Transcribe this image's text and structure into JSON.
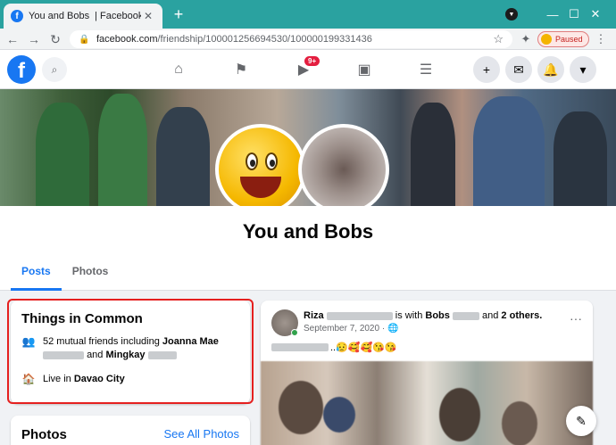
{
  "browser": {
    "tab_title_left": "You and Bobs",
    "tab_title_right": "| Facebook",
    "url_host": "facebook.com",
    "url_path": "/friendship/100001256694530/100000199331436",
    "profile_status": "Paused"
  },
  "fb_nav": {
    "notification_badge": "9+"
  },
  "page": {
    "title": "You and Bobs",
    "tabs": [
      "Posts",
      "Photos"
    ]
  },
  "things_in_common": {
    "title": "Things in Common",
    "mutual_prefix": "52 mutual friends including",
    "friend1_first": "Joanna Mae",
    "mutual_and": "and",
    "friend2_first": "Mingkay",
    "live_prefix": "Live in",
    "city": "Davao City"
  },
  "photos_card": {
    "title": "Photos",
    "see_all": "See All Photos"
  },
  "post": {
    "author_first": "Riza",
    "with_text": "is with",
    "with_name": "Bobs",
    "and_text": "and",
    "others": "2 others",
    "date": "September 7, 2020 ·",
    "body_suffix": "..😥🥰🥰😘😘"
  },
  "colors": {
    "fb_blue": "#1877f2",
    "tab_strip": "#2aa2a0",
    "highlight_red": "#e5201f"
  }
}
